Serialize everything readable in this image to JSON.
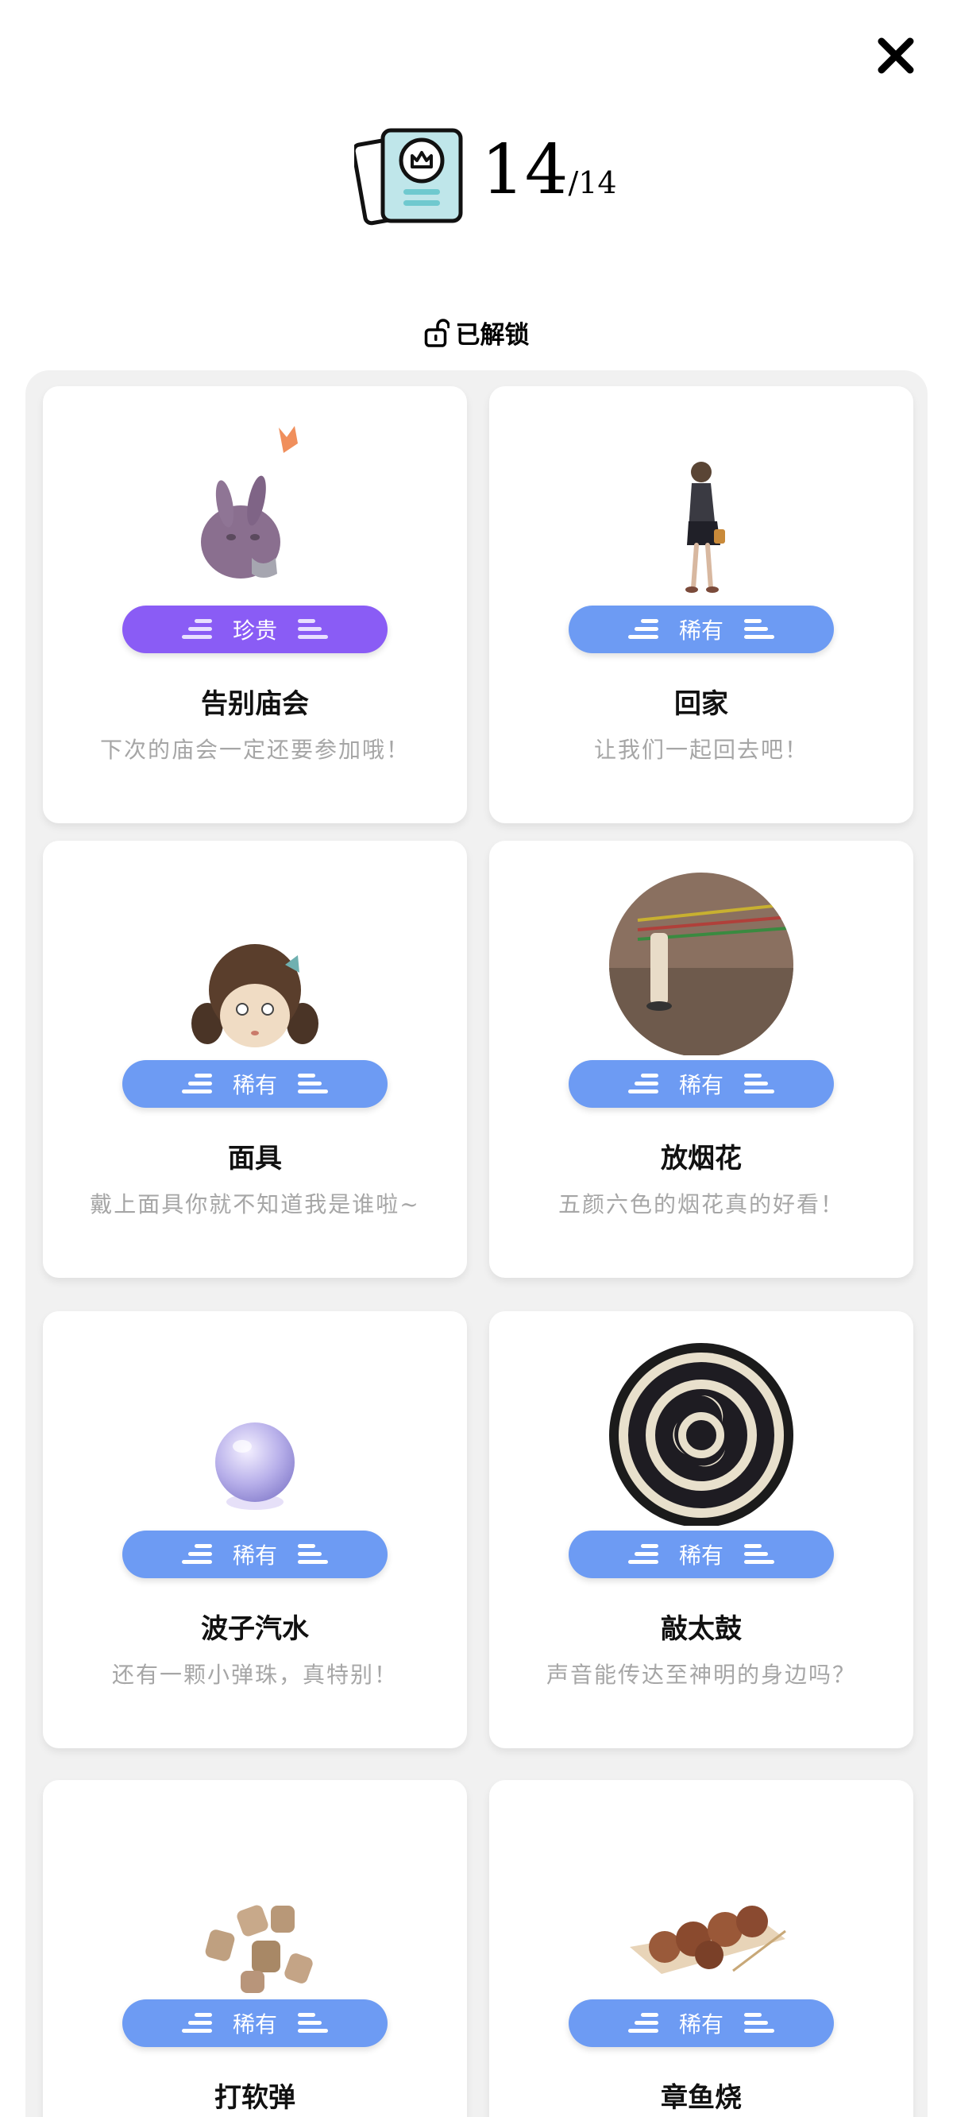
{
  "header": {
    "count_unlocked": "14",
    "count_total": "/14",
    "icon": "collection-card-icon"
  },
  "close": {
    "icon": "close-icon"
  },
  "section": {
    "label": "已解锁",
    "icon": "unlock-icon"
  },
  "cards": [
    {
      "rarity": "珍贵",
      "title": "告别庙会",
      "desc": "下次的庙会一定还要参加哦！",
      "art": "bunny-mask"
    },
    {
      "rarity": "稀有",
      "title": "回家",
      "desc": "让我们一起回去吧！",
      "art": "walking-girl"
    },
    {
      "rarity": "稀有",
      "title": "面具",
      "desc": "戴上面具你就不知道我是谁啦~",
      "art": "doll-mask"
    },
    {
      "rarity": "稀有",
      "title": "放烟花",
      "desc": "五颜六色的烟花真的好看！",
      "art": "fireworks-photo"
    },
    {
      "rarity": "稀有",
      "title": "波子汽水",
      "desc": "还有一颗小弹珠，真特别！",
      "art": "marble"
    },
    {
      "rarity": "稀有",
      "title": "敲太鼓",
      "desc": "声音能传达至神明的身边吗？",
      "art": "taiko-drum"
    },
    {
      "rarity": "稀有",
      "title": "打软弹",
      "desc": "",
      "art": "corks"
    },
    {
      "rarity": "稀有",
      "title": "章鱼烧",
      "desc": "",
      "art": "takoyaki"
    }
  ],
  "colors": {
    "rare": "#6d9bf3",
    "precious": "#8a5cf5"
  }
}
